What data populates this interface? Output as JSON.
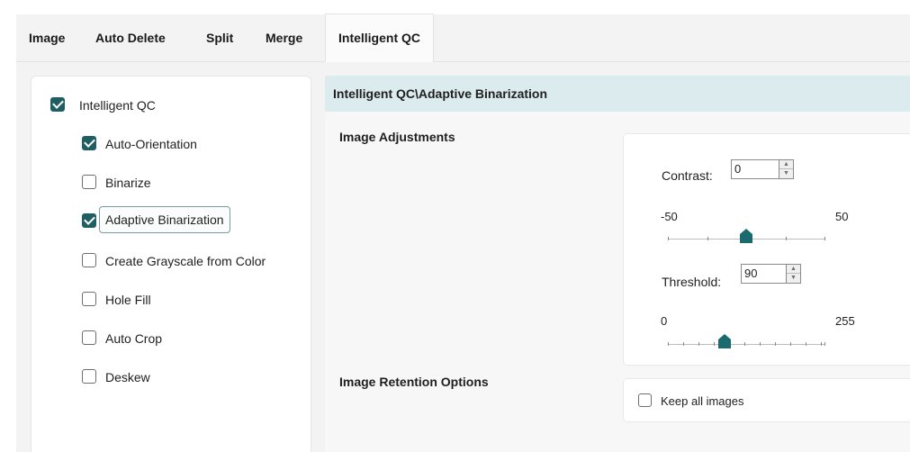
{
  "tabs": {
    "image": "Image",
    "auto_delete": "Auto Delete",
    "split": "Split",
    "merge": "Merge",
    "intelligent_qc": "Intelligent QC",
    "active": "Intelligent QC"
  },
  "tree": {
    "root": {
      "label": "Intelligent QC",
      "checked": true
    },
    "items": [
      {
        "label": "Auto-Orientation",
        "checked": true
      },
      {
        "label": "Binarize",
        "checked": false
      },
      {
        "label": "Adaptive Binarization",
        "checked": true,
        "selected": true
      },
      {
        "label": "Create Grayscale from Color",
        "checked": false
      },
      {
        "label": "Hole Fill",
        "checked": false
      },
      {
        "label": "Auto Crop",
        "checked": false
      },
      {
        "label": "Deskew",
        "checked": false
      }
    ]
  },
  "breadcrumb": "Intelligent QC\\Adaptive Binarization",
  "image_adjustments": {
    "title": "Image Adjustments",
    "contrast": {
      "label": "Contrast:",
      "value": "0",
      "min_label": "-50",
      "max_label": "50",
      "level": 0
    },
    "threshold": {
      "label": "Threshold:",
      "value": "90",
      "min_label": "0",
      "max_label": "255",
      "level": 90
    }
  },
  "retention": {
    "title": "Image Retention Options",
    "keep_all": {
      "label": "Keep all images",
      "checked": false
    }
  },
  "colors": {
    "accent": "#1f5e63",
    "thumb": "#1b6b6e",
    "breadcrumb_bg": "#dcecee",
    "tabbar_bg": "#f3f3f3"
  },
  "icons": [
    "checkbox-checked-icon",
    "checkbox-unchecked-icon",
    "spin-up-icon",
    "spin-down-icon",
    "slider-thumb-icon"
  ]
}
